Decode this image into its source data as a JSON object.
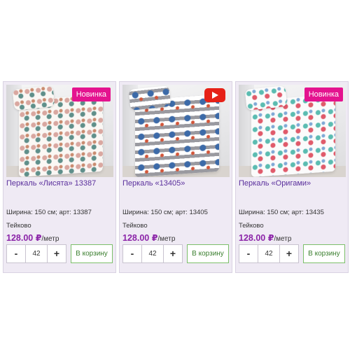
{
  "products": [
    {
      "title": "Перкаль «Лисята» 13387",
      "spec": "Ширина: 150 см; арт: 13387",
      "city": "Тейково",
      "price": "128.00 ₽",
      "unit": "/метр",
      "qty_minus": "-",
      "qty_value": "42",
      "qty_plus": "+",
      "cart_label": "В корзину",
      "badge": "Новинка",
      "pattern": "leaves-foxes"
    },
    {
      "title": "Перкаль «13405»",
      "spec": "Ширина: 150 см; арт: 13405",
      "city": "Тейково",
      "price": "128.00 ₽",
      "unit": "/метр",
      "qty_minus": "-",
      "qty_value": "42",
      "qty_plus": "+",
      "cart_label": "В корзину",
      "badge_icon": "youtube-play-icon",
      "pattern": "grey-stripes-nautical"
    },
    {
      "title": "Перкаль «Оригами»",
      "spec": "Ширина: 150 см; арт: 13435",
      "city": "Тейково",
      "price": "128.00 ₽",
      "unit": "/метр",
      "qty_minus": "-",
      "qty_value": "42",
      "qty_plus": "+",
      "cart_label": "В корзину",
      "badge": "Новинка",
      "pattern": "origami-animals"
    }
  ],
  "colors": {
    "card_bg": "#efeaf4",
    "title": "#5a2f9c",
    "price": "#8b24a8",
    "badge_new": "#e4138f",
    "youtube": "#e62117",
    "cart_border": "#7cbf6a"
  }
}
